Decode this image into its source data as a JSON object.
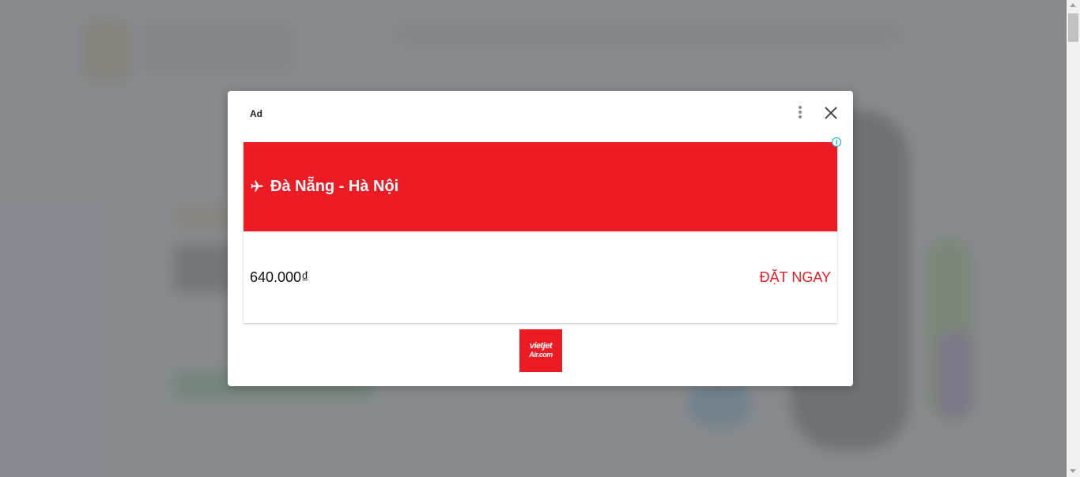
{
  "modal": {
    "ad_label": "Ad",
    "menu_icon": "more-vert-icon",
    "close_icon": "close-icon"
  },
  "ad": {
    "route": "Đà Nẵng - Hà Nội",
    "price": "640.000₫",
    "cta": "ĐẶT NGAY",
    "info_icon": "adchoices-info-icon",
    "plane_icon": "airplane-icon",
    "logo": {
      "line1": "vietjet",
      "line2": "Air.com"
    }
  },
  "colors": {
    "brand_red": "#ed1c24",
    "overlay": "#7c8084",
    "info_cyan": "#00aecd"
  }
}
